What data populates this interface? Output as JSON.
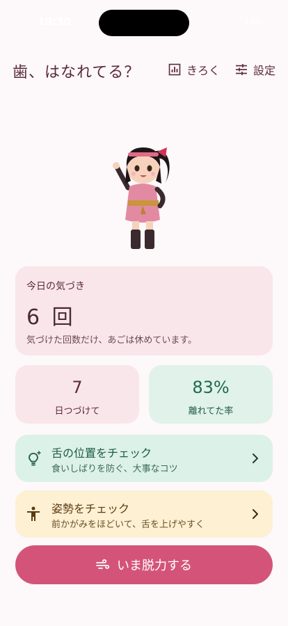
{
  "status_bar": {
    "time": "10:30",
    "battery": "100"
  },
  "header": {
    "title": "歯、はなれてる？",
    "history_label": "きろく",
    "settings_label": "設定"
  },
  "today": {
    "label": "今日の気づき",
    "count": "6 回",
    "description": "気づけた回数だけ、あごは休めています。"
  },
  "stats": {
    "streak_value": "7",
    "streak_label": "日つづけて",
    "rate_value": "83%",
    "rate_label": "離れてた率"
  },
  "actions": {
    "tongue_title": "舌の位置をチェック",
    "tongue_sub": "食いしばりを防ぐ、大事なコツ",
    "posture_title": "姿勢をチェック",
    "posture_sub": "前かがみをほどいて、舌を上げやすく"
  },
  "relax_button": {
    "label": "いま脱力する"
  },
  "icons": {
    "history": "bar-chart-icon",
    "settings": "sliders-icon",
    "tongue": "lightbulb-icon",
    "posture": "person-icon",
    "relax": "wind-icon"
  },
  "colors": {
    "background": "#fdf8f9",
    "primary": "#d45479",
    "pink_card": "#f9e6ea",
    "green_card": "#dcf1e8",
    "yellow_card": "#fdf0d3"
  }
}
